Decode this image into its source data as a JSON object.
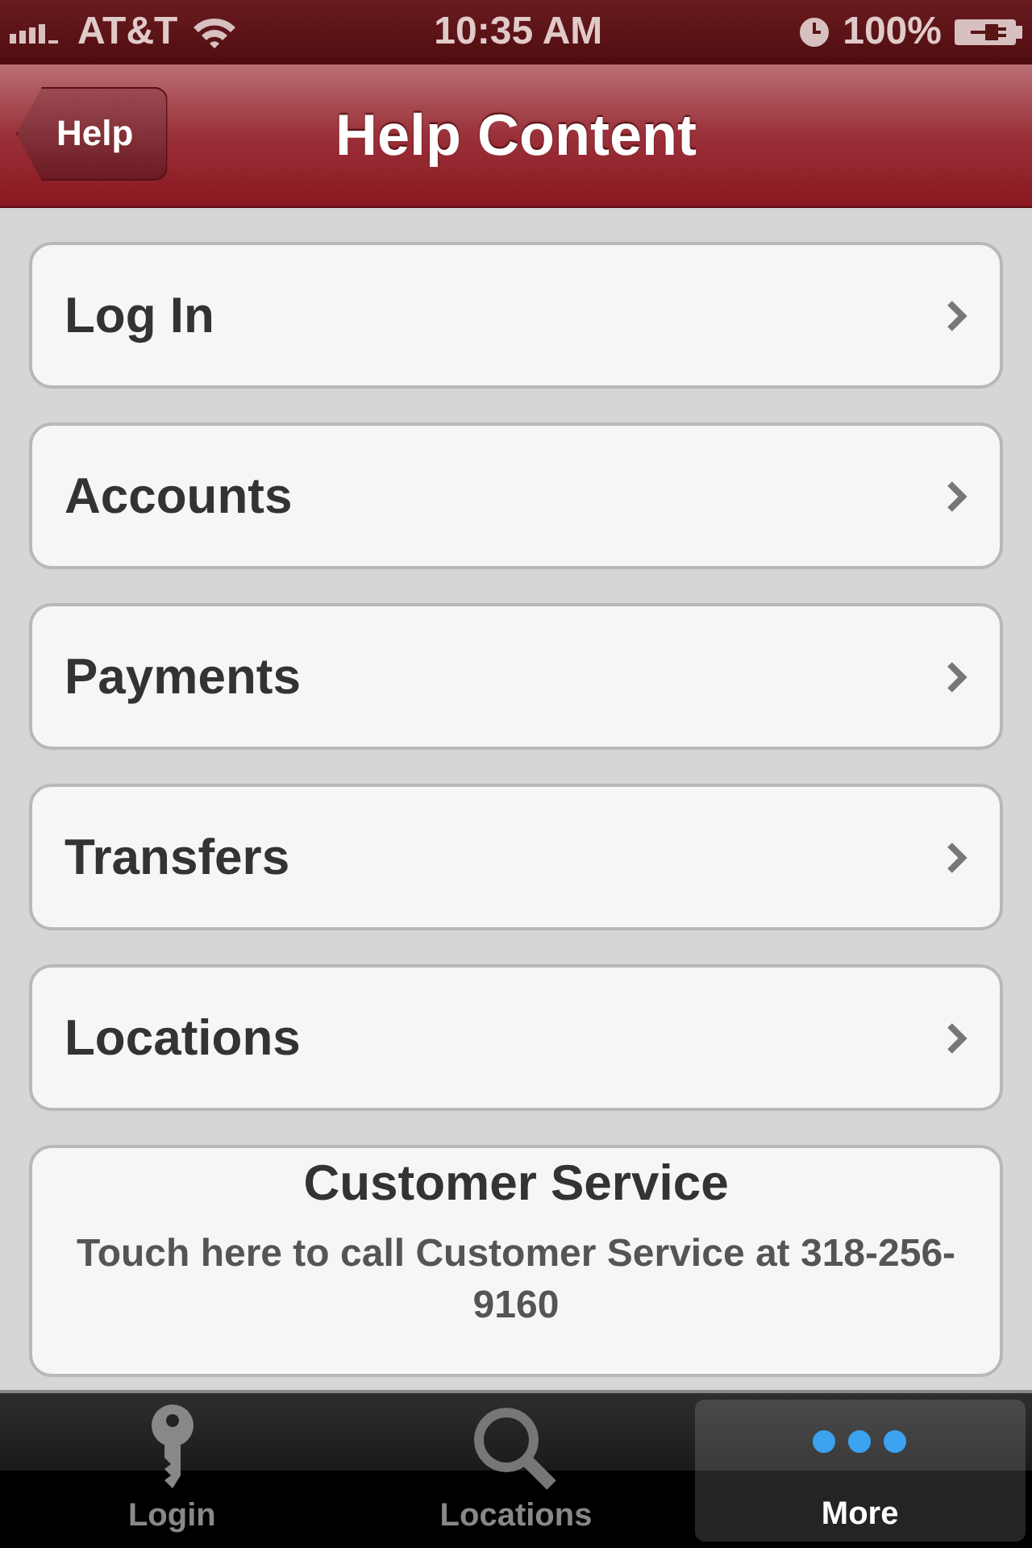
{
  "status_bar": {
    "carrier": "AT&T",
    "time": "10:35 AM",
    "battery": "100%"
  },
  "nav_bar": {
    "back": "Help",
    "title": "Help Content"
  },
  "items": [
    {
      "label": "Log In"
    },
    {
      "label": "Accounts"
    },
    {
      "label": "Payments"
    },
    {
      "label": "Transfers"
    },
    {
      "label": "Locations"
    }
  ],
  "contact": {
    "title": "Customer Service",
    "text": "Touch here to call Customer Service at 318-256-9160"
  },
  "tabs": [
    {
      "label": "Login",
      "kind": "key",
      "selected": false
    },
    {
      "label": "Locations",
      "kind": "search",
      "selected": false
    },
    {
      "label": "More",
      "kind": "more",
      "selected": true
    }
  ]
}
